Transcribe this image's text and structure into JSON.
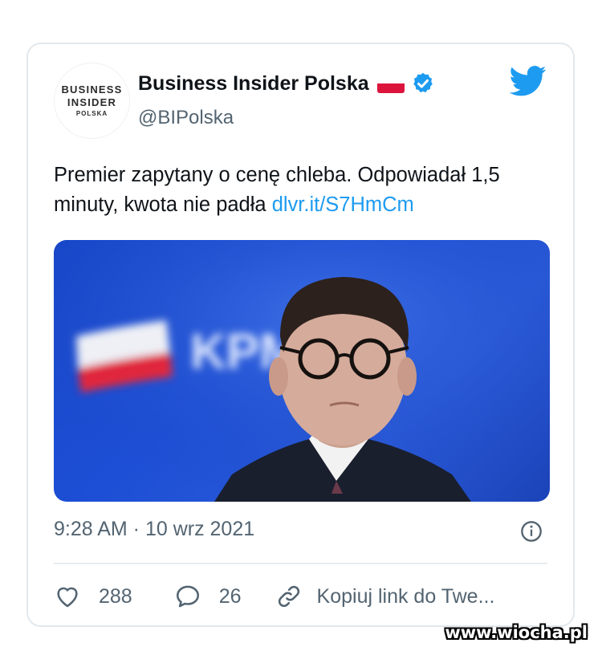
{
  "tweet": {
    "avatar": {
      "line1": "BUSINESS",
      "line2": "INSIDER",
      "line3": "POLSKA"
    },
    "display_name": "Business Insider Polska",
    "handle": "@BIPolska",
    "text": "Premier zapytany o cenę chleba. Odpowiadał 1,5 minuty, kwota nie padła ",
    "link": "dlvr.it/S7HmCm",
    "timestamp": "9:28 AM · 10 wrz 2021",
    "image_text": "KPM",
    "actions": {
      "likes": "288",
      "replies": "26",
      "copy_link": "Kopiuj link do Twe..."
    }
  },
  "watermark": "www.wiocha.pl",
  "colors": {
    "twitter_blue": "#1d9bf0",
    "flag_red": "#dc143c",
    "text_secondary": "#536471"
  },
  "icons": [
    "poland-flag-icon",
    "verified-badge-icon",
    "twitter-bird-icon",
    "info-icon",
    "heart-icon",
    "reply-icon",
    "link-icon"
  ]
}
